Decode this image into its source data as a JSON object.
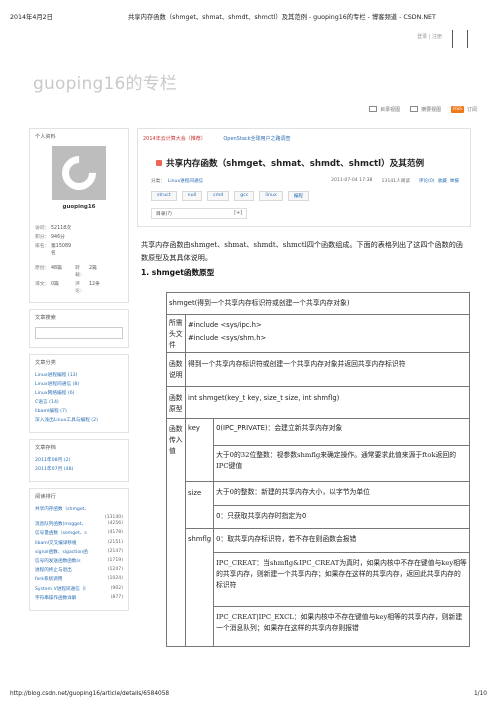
{
  "print_header": {
    "date": "2014年4月2日",
    "title": "共享内存函数（shmget、shmat、shmdt、shmctl）及其范例 - guoping16的专栏 - 博客频道 - CSDN.NET"
  },
  "topbar": {
    "login": "登录",
    "sep": "|",
    "register": "注册"
  },
  "blog_title": "guoping16的专栏",
  "viewbar": {
    "list_view": "目录视图",
    "summary_view": "摘要视图",
    "rss_badge": "RSS",
    "subscribe": "订阅"
  },
  "sidebar": {
    "profile_head": "个人资料",
    "username": "guoping16",
    "stats": [
      {
        "k": "访问：",
        "v": "52118次"
      },
      {
        "k": "积分：",
        "v": "946分"
      },
      {
        "k": "排名：",
        "v": "第15089名"
      }
    ],
    "stats2": [
      {
        "k": "原创：",
        "v": "48篇",
        "k2": "转载：",
        "v2": "2篇"
      },
      {
        "k": "译文：",
        "v": "0篇",
        "k2": "评论：",
        "v2": "12条"
      }
    ],
    "search_head": "文章搜索",
    "category_head": "文章分类",
    "categories": [
      "Linux进程编程 (13)",
      "Linux进程间通信 (8)",
      "Linux网络编程 (6)",
      "C语言 (14)",
      "libaml编程 (7)",
      "深入浅出Linux工具与编程 (2)"
    ],
    "archive_head": "文章存档",
    "archives": [
      "2011年08月 (2)",
      "2011年07月 (48)"
    ],
    "rank_head": "阅读排行",
    "rank": [
      {
        "t": "共享内存函数（shmget、",
        "n": ""
      },
      {
        "t": "消息队列函数(msgget、",
        "n": "(13140)\n(4256)"
      },
      {
        "t": "信号量函数（semget、s",
        "n": "(4178)"
      },
      {
        "t": "libaml交叉编译移植",
        "n": "(2151)"
      },
      {
        "t": "signal函数、sigaction函",
        "n": "(2147)"
      },
      {
        "t": "信号的发送函数函数(s",
        "n": "(1719)"
      },
      {
        "t": "进程的终止与退出",
        "n": "(1247)"
      },
      {
        "t": "fork系统调用",
        "n": "(1024)"
      },
      {
        "t": "System V进程间通信（I",
        "n": "(902)"
      },
      {
        "t": "字符串操作函数详解",
        "n": "(877)"
      }
    ]
  },
  "article": {
    "promo": "2014年云计算大会（推荐）",
    "promo_link": "OpenStack全球用户之路调查",
    "title": "共享内存函数（shmget、shmat、shmdt、shmctl）及其范例",
    "meta": {
      "category_label": "分类：",
      "category": "Linux进程间通信",
      "date": "2011-07-04 17:38",
      "reads": "13141人阅读",
      "comments": "评论(0)",
      "collect": "收藏",
      "report": "举报"
    },
    "tags": [
      "struct",
      "null",
      "cmd",
      "gcc",
      "linux",
      "编程"
    ],
    "toc_label": "目录(?)",
    "toc_toggle": "[+]",
    "intro": "共享内存函数由shmget、shmat、shmdt、shmctl四个函数组成。下面的表格列出了这四个函数的函数原型及其具体说明。",
    "section": "1.   shmget函数原型"
  },
  "table": {
    "title_row": "shmget(得到一个共享内存标识符或创建一个共享内存对象)",
    "headfile_label": "所需头文件",
    "headfiles": [
      "#include <sys/ipc.h>",
      "#include <sys/shm.h>"
    ],
    "desc_label": "函数说明",
    "desc": "得到一个共享内存标识符或创建一个共享内存对象并返回共享内存标识符",
    "proto_label": "函数原型",
    "proto": "int shmget(key_t key, size_t size, int shmflg)",
    "param_label": "函数传入值",
    "params": {
      "key": "key",
      "key_rows": [
        "0(IPC_PRIVATE)：会建立新共享内存对象",
        "大于0的32位整数：视参数shmflg来确定操作。通常要求此值来源于ftok返回的IPC键值"
      ],
      "size": "size",
      "size_rows": [
        "大于0的整数：新建的共享内存大小，以字节为单位",
        "0：只获取共享内存时指定为0"
      ],
      "shmflg": "shmflg",
      "shmflg_rows": [
        "0：取共享内存标识符，若不存在则函数会报错",
        "IPC_CREAT：当shmflg&IPC_CREAT为真时，如果内核中不存在键值与key相等的共享内存，则新建一个共享内存；如果存在这样的共享内存，返回此共享内存的标识符",
        "IPC_CREAT|IPC_EXCL：如果内核中不存在键值与key相等的共享内存，则新建一个消息队列；如果存在这样的共享内存则报错"
      ]
    }
  },
  "print_footer": {
    "url": "http://blog.csdn.net/guoping16/article/details/6584058",
    "page": "1/10"
  }
}
